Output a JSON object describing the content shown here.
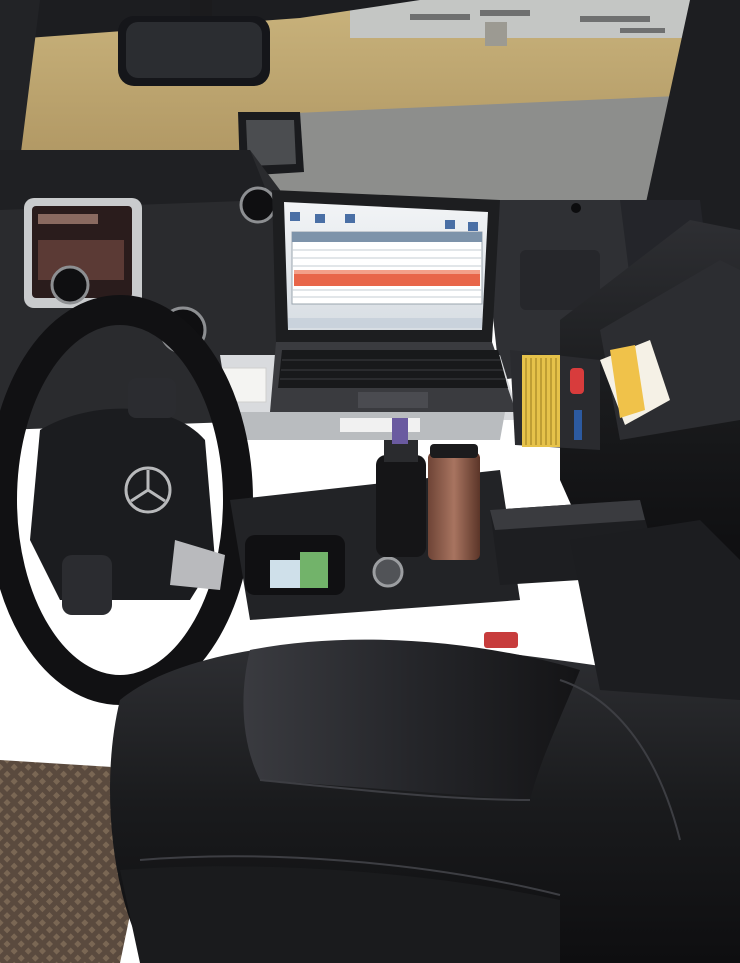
{
  "photo": {
    "subject": "car-interior-mobile-office",
    "colors": {
      "leather": "#1c1c1e",
      "dashboard": "#2a2b2e",
      "grass": "#b8a06a",
      "road": "#8d8e8c",
      "laptop_screen": "#e9ecef",
      "spreadsheet_highlight": "#e8664a",
      "folder_yellow": "#e6c24a",
      "floor_mat": "#6b5a4c",
      "tumbler_copper": "#8a5a48"
    }
  }
}
